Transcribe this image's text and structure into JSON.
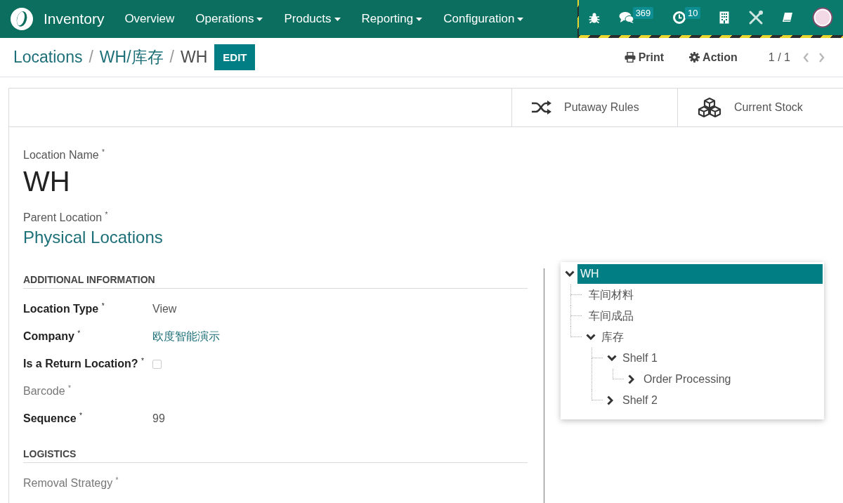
{
  "navbar": {
    "app_name": "Inventory",
    "menus": [
      {
        "label": "Overview",
        "dropdown": false
      },
      {
        "label": "Operations",
        "dropdown": true
      },
      {
        "label": "Products",
        "dropdown": true
      },
      {
        "label": "Reporting",
        "dropdown": true
      },
      {
        "label": "Configuration",
        "dropdown": true
      }
    ],
    "systray": [
      {
        "kind": "bug"
      },
      {
        "kind": "chat",
        "badge": "369"
      },
      {
        "kind": "clock",
        "badge": "10"
      },
      {
        "kind": "building"
      },
      {
        "kind": "tools"
      },
      {
        "kind": "book"
      },
      {
        "kind": "avatar"
      }
    ]
  },
  "breadcrumbs": [
    {
      "kind": "link",
      "label": "Locations"
    },
    {
      "kind": "separator",
      "label": "/"
    },
    {
      "kind": "link",
      "label": "WH/库存"
    },
    {
      "kind": "separator",
      "label": "/"
    },
    {
      "kind": "current",
      "label": "WH"
    }
  ],
  "edit_button": "EDIT",
  "actions": [
    {
      "kind": "print",
      "label": "Print"
    },
    {
      "kind": "gear",
      "label": "Action"
    }
  ],
  "pager": {
    "text": "1 / 1",
    "prev_disabled": true,
    "next_disabled": true
  },
  "smart_buttons": [
    {
      "kind": "shuffle",
      "label": "Putaway Rules"
    },
    {
      "kind": "cubes",
      "label": "Current Stock"
    }
  ],
  "title_field": {
    "label": "Location Name $^{*}$",
    "value": "WH"
  },
  "parent_field": {
    "label": "Parent Location $^{*}$",
    "value": "Physical Locations"
  },
  "sections": [
    {
      "title": "ADDITIONAL INFORMATION",
      "fields": [
        {
          "label": "Location Type $^{*}$",
          "bold": true,
          "kind": "text",
          "value": "View"
        },
        {
          "label": "Company $^{*}$",
          "bold": true,
          "kind": "link",
          "value": "欧度智能演示"
        },
        {
          "label": "Is a Return Location? $^{*}$",
          "bold": true,
          "kind": "checkbox",
          "checked": false
        },
        {
          "label": "Barcode $^{*}$",
          "bold": false,
          "kind": "empty"
        },
        {
          "label": "Sequence $^{*}$",
          "bold": true,
          "kind": "text",
          "value": "99"
        }
      ]
    },
    {
      "title": "LOGISTICS",
      "fields": [
        {
          "label": "Removal Strategy $^{*}$",
          "bold": false,
          "kind": "empty"
        }
      ]
    }
  ],
  "tree": [
    {
      "label": "WH",
      "selected": true,
      "expanded": true,
      "children": [
        {
          "label": "车间材料",
          "selected": false
        },
        {
          "label": "车间成品",
          "selected": false
        },
        {
          "label": "库存",
          "selected": false,
          "expanded": true,
          "children": [
            {
              "label": "Shelf 1",
              "selected": false,
              "expanded": true,
              "children": [
                {
                  "label": "Order Processing",
                  "selected": false,
                  "expanded": false
                }
              ]
            },
            {
              "label": "Shelf 2",
              "selected": false,
              "expanded": false
            }
          ]
        }
      ]
    }
  ]
}
